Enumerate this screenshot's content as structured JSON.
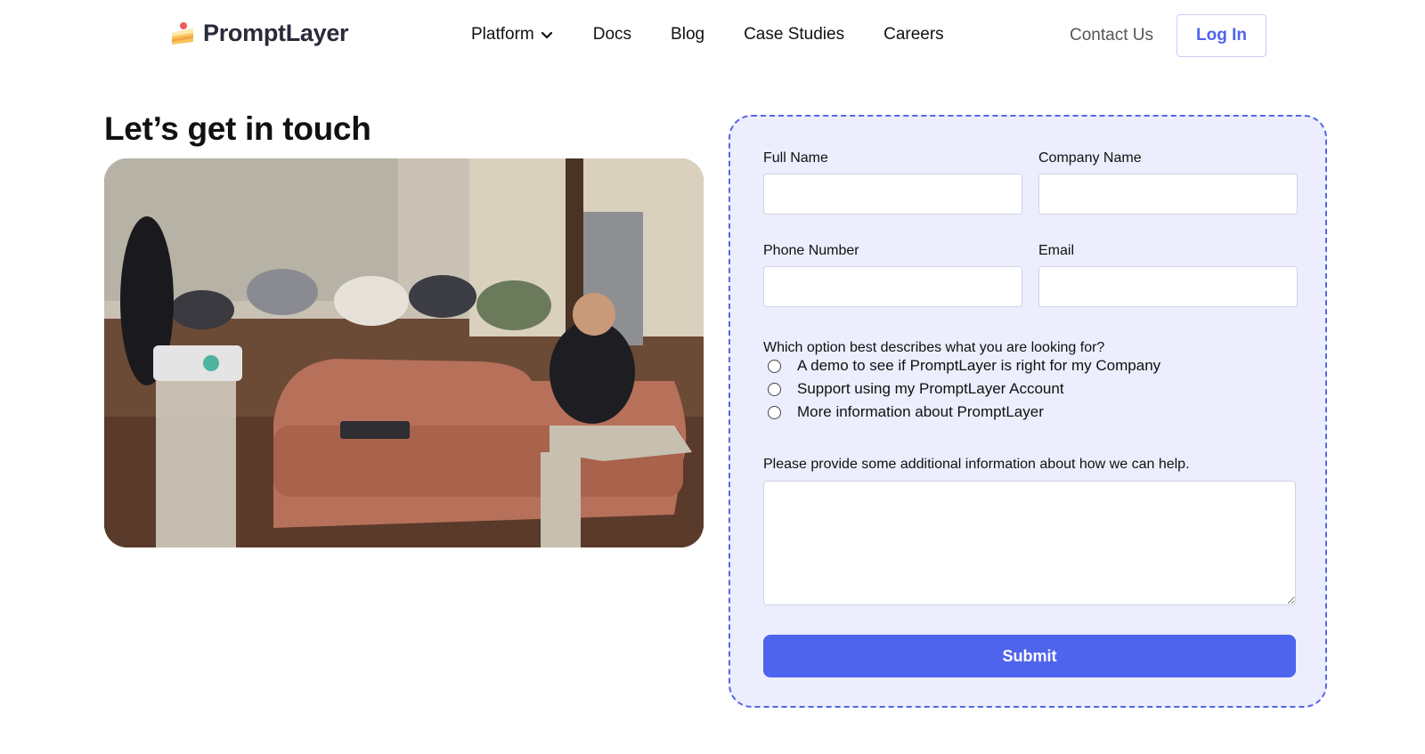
{
  "brand": {
    "name": "PromptLayer",
    "accent": "#4f64ec",
    "card_bg": "#eceefd"
  },
  "nav": {
    "items": [
      {
        "label": "Platform",
        "has_dropdown": true
      },
      {
        "label": "Docs"
      },
      {
        "label": "Blog"
      },
      {
        "label": "Case Studies"
      },
      {
        "label": "Careers"
      }
    ],
    "contact_label": "Contact Us",
    "login_label": "Log In"
  },
  "main": {
    "title": "Let’s get in touch"
  },
  "form": {
    "full_name_label": "Full Name",
    "company_label": "Company Name",
    "phone_label": "Phone Number",
    "email_label": "Email",
    "question": "Which option best describes what you are looking for?",
    "options": [
      "A demo to see if PromptLayer is right for my Company",
      "Support using my PromptLayer Account",
      "More information about PromptLayer"
    ],
    "help_label": "Please provide some additional information about how we can help.",
    "submit_label": "Submit"
  }
}
